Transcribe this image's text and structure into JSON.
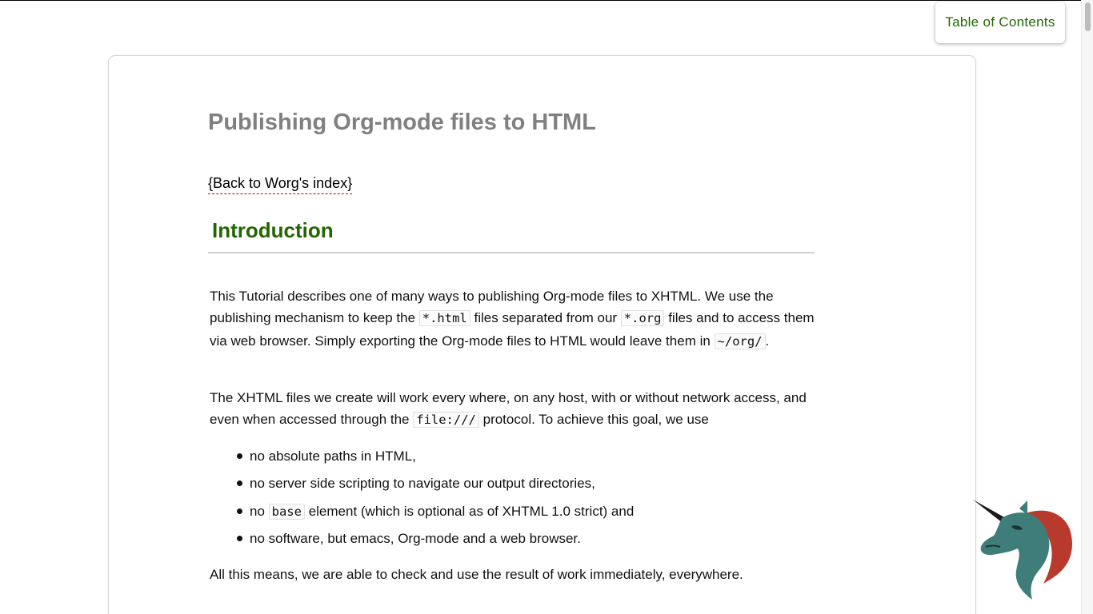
{
  "toc": {
    "label": "Table of Contents"
  },
  "title": "Publishing Org-mode files to HTML",
  "back_link": "{Back to Worg's index}",
  "section": {
    "title": "Introduction"
  },
  "p1": {
    "t1": "This Tutorial describes one of many ways to publishing Org-mode files to XHTML. We use the publishing mechanism to keep the ",
    "c1": "*.html",
    "t2": " files separated from our ",
    "c2": "*.org",
    "t3": " files and to access them via web browser. Simply exporting the Org-mode files to HTML would leave them in ",
    "c3": "~/org/",
    "t4": "."
  },
  "p2": {
    "t1": "The XHTML files we create will work every where, on any host, with or without network access, and even when accessed through the ",
    "c1": "file:///",
    "t2": " protocol. To achieve this goal, we use"
  },
  "bullets": {
    "b1": "no absolute paths in HTML,",
    "b2": "no server side scripting to navigate our output directories,",
    "b3_pre": "no ",
    "b3_code": "base",
    "b3_post": " element (which is optional as of XHTML 1.0 strict) and",
    "b4": "no software, but emacs, Org-mode and a web browser."
  },
  "p3": "All this means, we are able to check and use the result of work immediately, everywhere.",
  "logo": {
    "icon": "org-mode-unicorn-logo"
  },
  "colors": {
    "accent_green": "#236600",
    "title_gray": "#808080",
    "link_underline": "#cc0000"
  }
}
